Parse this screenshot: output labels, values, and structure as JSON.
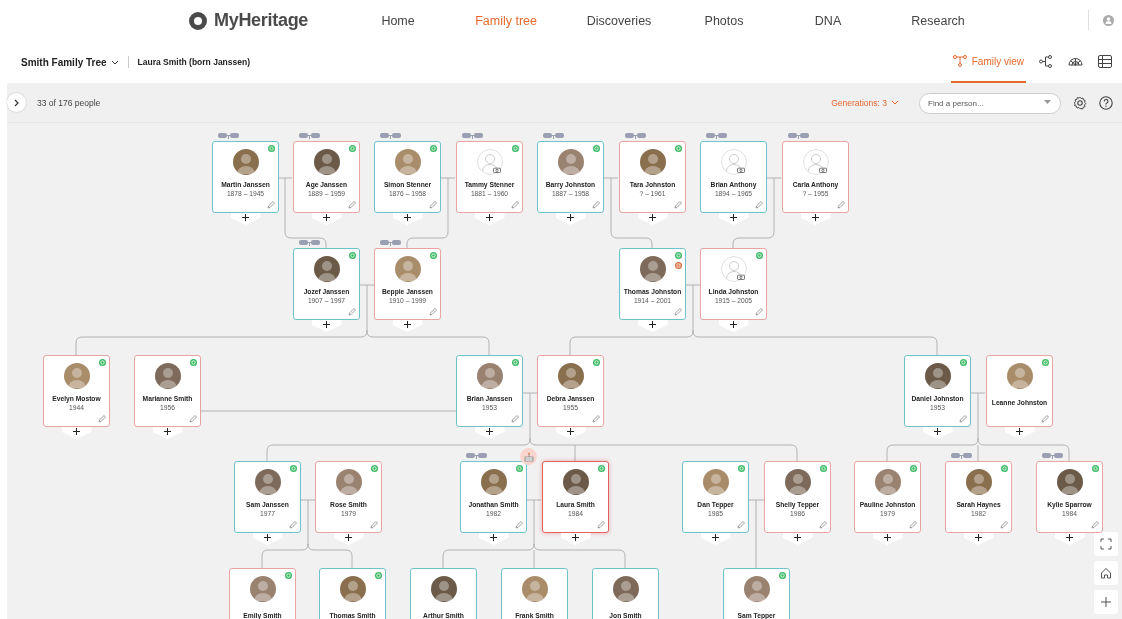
{
  "header": {
    "logo": "MyHeritage",
    "nav": [
      {
        "label": "Home",
        "selected": false
      },
      {
        "label": "Family tree",
        "selected": true
      },
      {
        "label": "Discoveries",
        "selected": false
      },
      {
        "label": "Photos",
        "selected": false
      },
      {
        "label": "DNA",
        "selected": false
      },
      {
        "label": "Research",
        "selected": false
      }
    ]
  },
  "tree_bar": {
    "tree_name": "Smith Family Tree",
    "person": "Laura Smith (born Janssen)",
    "views": [
      {
        "kind": "family",
        "label": "Family view",
        "selected": true
      },
      {
        "kind": "pedigree",
        "selected": false
      },
      {
        "kind": "fan",
        "selected": false
      },
      {
        "kind": "list",
        "selected": false
      }
    ]
  },
  "toolbar": {
    "count": "33 of 176 people",
    "generations": "Generations: 3",
    "search": {
      "placeholder": "Find a person..."
    }
  },
  "generations": [
    {
      "people": [
        {
          "name": "Martin Janssen",
          "dates": "1878 – 1945",
          "kind": "male",
          "photo": true,
          "match": true,
          "parents_link": true,
          "selected": false
        },
        {
          "name": "Age Janssen",
          "dates": "1889 – 1959",
          "kind": "female",
          "photo": true,
          "match": true,
          "parents_link": true,
          "selected": false
        },
        {
          "name": "Simon Stenner",
          "dates": "1876 – 1958",
          "kind": "male",
          "photo": true,
          "match": true,
          "parents_link": true,
          "selected": false
        },
        {
          "name": "Tammy Stenner",
          "dates": "1881 – 1960",
          "kind": "female",
          "photo": false,
          "match": true,
          "parents_link": true,
          "selected": false
        },
        {
          "name": "Barry Johnston",
          "dates": "1887 – 1958",
          "kind": "male",
          "photo": true,
          "match": true,
          "parents_link": true,
          "selected": false
        },
        {
          "name": "Tara Johnston",
          "dates": "? – 1961",
          "kind": "female",
          "photo": true,
          "match": true,
          "parents_link": true,
          "selected": false
        },
        {
          "name": "Brian Anthony",
          "dates": "1894 – 1965",
          "kind": "male",
          "photo": false,
          "match": false,
          "parents_link": true,
          "selected": false
        },
        {
          "name": "Carla Anthony",
          "dates": "? – 1955",
          "kind": "female",
          "photo": false,
          "match": false,
          "parents_link": true,
          "selected": false
        }
      ]
    },
    {
      "people": [
        {
          "name": "Jozef Janssen",
          "dates": "1907 – 1997",
          "kind": "male",
          "photo": true,
          "match": true,
          "parents_link": true,
          "selected": false
        },
        {
          "name": "Beppie Janssen",
          "dates": "1910 – 1999",
          "kind": "female",
          "photo": true,
          "match": true,
          "parents_link": true,
          "selected": false
        },
        {
          "name": "Thomas Johnston",
          "dates": "1914 – 2001",
          "kind": "male",
          "photo": true,
          "match": true,
          "record_match": true,
          "parents_link": false,
          "selected": false
        },
        {
          "name": "Linda Johnston",
          "dates": "1915 – 2005",
          "kind": "female",
          "photo": false,
          "match": true,
          "parents_link": false,
          "selected": false
        }
      ]
    },
    {
      "people": [
        {
          "name": "Evelyn Mostow",
          "dates": "1944",
          "kind": "female",
          "photo": true,
          "match": true,
          "parents_link": false,
          "selected": false
        },
        {
          "name": "Marianne Smith",
          "dates": "1956",
          "kind": "female",
          "photo": true,
          "match": true,
          "parents_link": false,
          "selected": false
        },
        {
          "name": "Brian Janssen",
          "dates": "1953",
          "kind": "male",
          "photo": true,
          "match": true,
          "parents_link": false,
          "selected": false
        },
        {
          "name": "Debra Janssen",
          "dates": "1955",
          "kind": "female",
          "photo": true,
          "match": true,
          "parents_link": false,
          "selected": false
        },
        {
          "name": "Daniel Johnston",
          "dates": "1953",
          "kind": "male",
          "photo": true,
          "match": true,
          "parents_link": false,
          "selected": false
        },
        {
          "name": "Leanne Johnston",
          "kind": "female",
          "photo": true,
          "match": true,
          "parents_link": false,
          "selected": false
        }
      ]
    },
    {
      "people": [
        {
          "name": "Sam Janssen",
          "dates": "1977",
          "kind": "male",
          "photo": true,
          "match": true,
          "parents_link": false,
          "selected": false
        },
        {
          "name": "Rose Smith",
          "dates": "1979",
          "kind": "female",
          "photo": true,
          "match": true,
          "parents_link": false,
          "selected": false
        },
        {
          "name": "Jonathan Smith",
          "dates": "1982",
          "kind": "male",
          "photo": true,
          "match": true,
          "parents_link": true,
          "selected": false
        },
        {
          "name": "Laura Smith",
          "dates": "1984",
          "kind": "female",
          "photo": true,
          "match": true,
          "parents_link": false,
          "birthday": true,
          "selected": true
        },
        {
          "name": "Dan Tepper",
          "dates": "1985",
          "kind": "male",
          "photo": true,
          "match": true,
          "parents_link": false,
          "selected": false
        },
        {
          "name": "Shelly Tepper",
          "dates": "1986",
          "kind": "female",
          "photo": true,
          "match": true,
          "parents_link": false,
          "selected": false
        },
        {
          "name": "Pauline Johnston",
          "dates": "1979",
          "kind": "female",
          "photo": true,
          "match": true,
          "parents_link": false,
          "selected": false
        },
        {
          "name": "Sarah Haynes",
          "dates": "1982",
          "kind": "female",
          "photo": true,
          "match": true,
          "parents_link": true,
          "selected": false
        },
        {
          "name": "Kylie Sparrow",
          "dates": "1984",
          "kind": "female",
          "photo": true,
          "match": true,
          "parents_link": true,
          "selected": false
        }
      ]
    },
    {
      "people": [
        {
          "name": "Emily Smith",
          "kind": "female",
          "photo": true,
          "match": true,
          "parents_link": false,
          "selected": false
        },
        {
          "name": "Thomas Smith",
          "kind": "male",
          "photo": true,
          "match": true,
          "parents_link": false,
          "selected": false
        },
        {
          "name": "Arthur Smith",
          "kind": "male",
          "photo": true,
          "match": false,
          "parents_link": false,
          "selected": false
        },
        {
          "name": "Frank Smith",
          "kind": "male",
          "photo": true,
          "match": false,
          "parents_link": false,
          "selected": false
        },
        {
          "name": "Jon Smith",
          "kind": "male",
          "photo": true,
          "match": false,
          "parents_link": false,
          "selected": false
        },
        {
          "name": "Sam Tepper",
          "kind": "male",
          "photo": true,
          "match": true,
          "parents_link": false,
          "selected": false
        }
      ]
    }
  ]
}
